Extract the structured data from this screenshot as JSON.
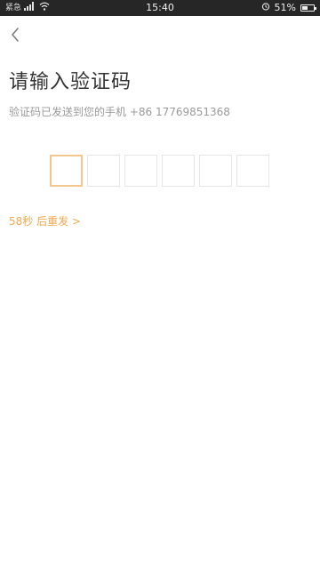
{
  "status_bar": {
    "carrier_text": "紧急",
    "time": "15:40",
    "battery_percent": "51%",
    "battery_level": 0.51
  },
  "page": {
    "title": "请输入验证码",
    "subtitle": "验证码已发送到您的手机 +86 17769851368",
    "code_digits": [
      "",
      "",
      "",
      "",
      "",
      ""
    ],
    "active_box_index": 0,
    "resend_label": "58秒 后重发 >"
  },
  "colors": {
    "accent": "#f0a850",
    "active_border": "#f5c58f",
    "box_border": "#e6e6e6",
    "title": "#333333",
    "subtitle": "#9a9a9a",
    "statusbar_bg": "#262626"
  },
  "icons": {
    "back": "chevron-left-icon",
    "signal": "signal-icon",
    "wifi": "wifi-icon",
    "alarm": "alarm-icon",
    "battery": "battery-icon"
  }
}
